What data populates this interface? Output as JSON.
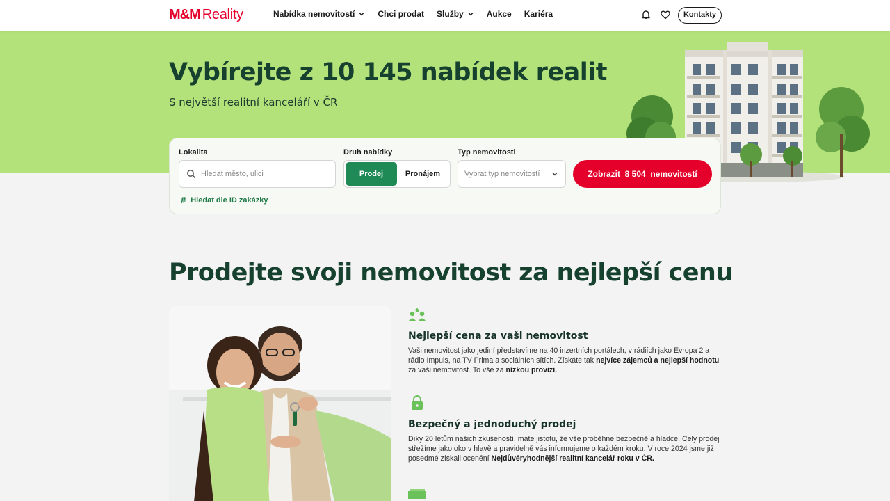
{
  "header": {
    "logo_mm": "M&M",
    "logo_reality": "Reality",
    "nav": [
      {
        "label": "Nabídka nemovitostí",
        "has_dropdown": true
      },
      {
        "label": "Chci prodat",
        "has_dropdown": false
      },
      {
        "label": "Služby",
        "has_dropdown": true
      },
      {
        "label": "Aukce",
        "has_dropdown": false
      },
      {
        "label": "Kariéra",
        "has_dropdown": false
      }
    ],
    "icons": [
      "bell-icon",
      "heart-icon"
    ],
    "contacts_label": "Kontakty"
  },
  "hero": {
    "title": "Vybírejte z 10 145 nabídek realit",
    "subtitle": "S největší realitní kanceláří v ČR"
  },
  "search": {
    "location_label": "Lokalita",
    "location_placeholder": "Hledat město, ulici",
    "offer_label": "Druh nabídky",
    "offer_options": [
      "Prodej",
      "Pronájem"
    ],
    "offer_selected": "Prodej",
    "type_label": "Typ nemovitosti",
    "type_placeholder": "Vybrat typ nemovitostí",
    "cta_label": "Zobrazit  8 504  nemovitostí",
    "id_link": "Hledat dle ID zakázky"
  },
  "section": {
    "title": "Prodejte svoji nemovitost za nejlepší cenu",
    "features": [
      {
        "icon": "people-icon",
        "title": "Nejlepší cena za vaši nemovitost",
        "t1": "Vaši nemovitost jako jediní představíme na 40 inzertních portálech, v rádiích jako Evropa 2 a rádio Impuls, na TV Prima a sociálních sítích. Získáte tak ",
        "b1": "nejvíce zájemců a nejlepší hodnotu",
        "t2": " za vaši nemovitost. To vše za ",
        "b2": "nízkou provizi.",
        "t3": ""
      },
      {
        "icon": "lock-icon",
        "title": "Bezpečný a jednoduchý prodej",
        "t1": "Díky 20 letům našich zkušeností, máte jistotu, že vše proběhne bezpečně a hladce. Celý prodej střežíme jako oko v hlavě a pravidelně vás informujeme o každém kroku. V roce 2024 jsme již posedmé získali ocenění ",
        "b1": "Nejdůvěryhodnější realitní kancelář roku v ČR.",
        "t2": "",
        "b2": "",
        "t3": ""
      }
    ]
  },
  "colors": {
    "brand_red": "#e4002b",
    "hero_green": "#b4e27a",
    "dark_green": "#17412f",
    "button_green": "#1f8a55"
  }
}
